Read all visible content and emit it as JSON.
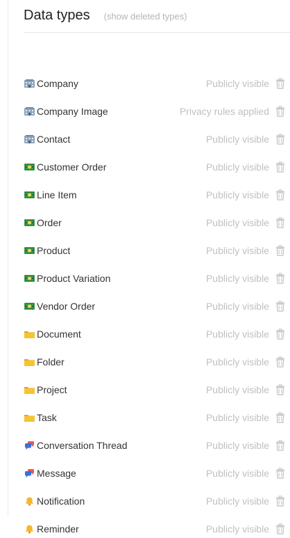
{
  "header": {
    "title": "Data types",
    "show_deleted_label": "(show deleted types)"
  },
  "colors": {
    "building": "#8ca4bc",
    "money": "#3f9d4f",
    "folder": "#f6c431",
    "speech": "#3b6fd8",
    "bell": "#f5b82a"
  },
  "types": [
    {
      "name": "Company",
      "icon": "building-icon",
      "privacy": "Publicly visible"
    },
    {
      "name": "Company Image",
      "icon": "building-icon",
      "privacy": "Privacy rules applied"
    },
    {
      "name": "Contact",
      "icon": "building-icon",
      "privacy": "Publicly visible"
    },
    {
      "name": "Customer Order",
      "icon": "money-icon",
      "privacy": "Publicly visible"
    },
    {
      "name": "Line Item",
      "icon": "money-icon",
      "privacy": "Publicly visible"
    },
    {
      "name": "Order",
      "icon": "money-icon",
      "privacy": "Publicly visible"
    },
    {
      "name": "Product",
      "icon": "money-icon",
      "privacy": "Publicly visible"
    },
    {
      "name": "Product Variation",
      "icon": "money-icon",
      "privacy": "Publicly visible"
    },
    {
      "name": "Vendor Order",
      "icon": "money-icon",
      "privacy": "Publicly visible"
    },
    {
      "name": "Document",
      "icon": "folder-icon",
      "privacy": "Publicly visible"
    },
    {
      "name": "Folder",
      "icon": "folder-icon",
      "privacy": "Publicly visible"
    },
    {
      "name": "Project",
      "icon": "folder-icon",
      "privacy": "Publicly visible"
    },
    {
      "name": "Task",
      "icon": "folder-icon",
      "privacy": "Publicly visible"
    },
    {
      "name": "Conversation Thread",
      "icon": "speech-bubble-icon",
      "privacy": "Publicly visible"
    },
    {
      "name": "Message",
      "icon": "speech-bubble-icon",
      "privacy": "Publicly visible"
    },
    {
      "name": "Notification",
      "icon": "bell-icon",
      "privacy": "Publicly visible"
    },
    {
      "name": "Reminder",
      "icon": "bell-icon",
      "privacy": "Publicly visible"
    }
  ]
}
